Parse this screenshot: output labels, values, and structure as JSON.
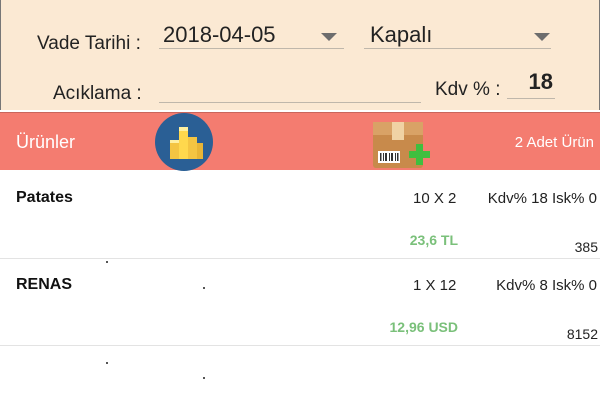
{
  "form": {
    "vade_label": "Vade Tarihi :",
    "vade_value": "2018-04-05",
    "status_value": "Kapalı",
    "aciklama_label": "Acıklama :",
    "aciklama_value": "",
    "kdv_label": "Kdv % :",
    "kdv_value": "18"
  },
  "products_bar": {
    "title": "Ürünler",
    "count_text": "2 Adet Ürün",
    "icons": [
      "stack-cube-icon",
      "package-add-icon"
    ],
    "color": "#f47c70"
  },
  "products": [
    {
      "name": "Patates",
      "qty": "10 X 2",
      "kdv_isk": "Kdv% 18  Isk% 0",
      "price": "23,6 TL",
      "code": "385"
    },
    {
      "name": "RENAS",
      "qty": "1 X 12",
      "kdv_isk": "Kdv% 8  Isk% 0",
      "price": "12,96 USD",
      "code": "8152"
    }
  ],
  "colors": {
    "form_bg": "#fbe9d3",
    "price_green": "#7ac07a"
  }
}
